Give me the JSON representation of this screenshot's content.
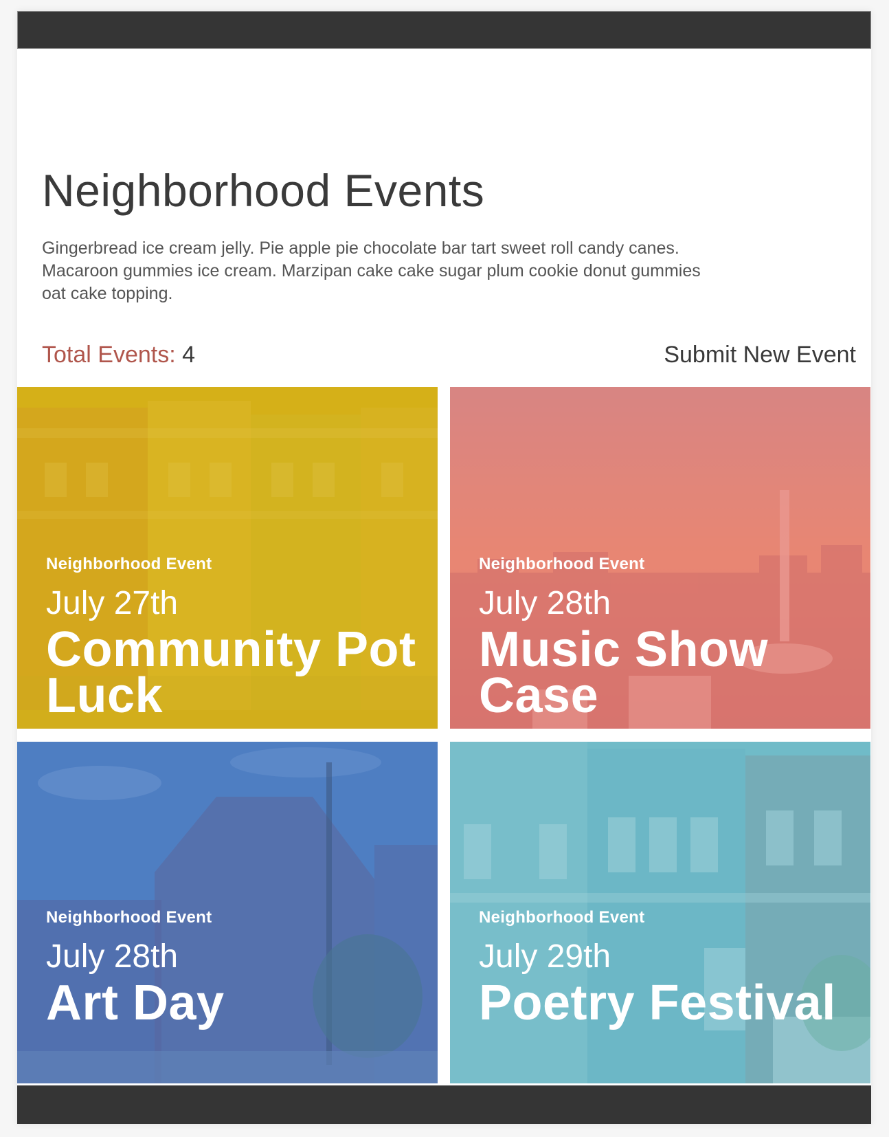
{
  "header": {
    "title": "Neighborhood Events"
  },
  "intro": {
    "text": "Gingerbread ice cream jelly. Pie apple pie chocolate bar tart sweet roll candy canes. Macaroon gummies ice cream. Marzipan cake cake sugar plum cookie donut gummies oat cake topping."
  },
  "summary": {
    "label": "Total Events:",
    "count": "4"
  },
  "actions": {
    "submit_label": "Submit New Event"
  },
  "colors": {
    "accent": "#b0564c",
    "bar": "#353535",
    "card1_tint": "#d9b418",
    "card2_tint": "#e48a82",
    "card3_tint": "#4f7fbf",
    "card4_tint": "#6fb9c8"
  },
  "events": [
    {
      "kicker": "Neighborhood Event",
      "date": "July 27th",
      "title": "Community Pot Luck"
    },
    {
      "kicker": "Neighborhood Event",
      "date": "July 28th",
      "title": "Music Show Case"
    },
    {
      "kicker": "Neighborhood Event",
      "date": "July 28th",
      "title": "Art Day"
    },
    {
      "kicker": "Neighborhood Event",
      "date": "July 29th",
      "title": "Poetry Festival"
    }
  ]
}
